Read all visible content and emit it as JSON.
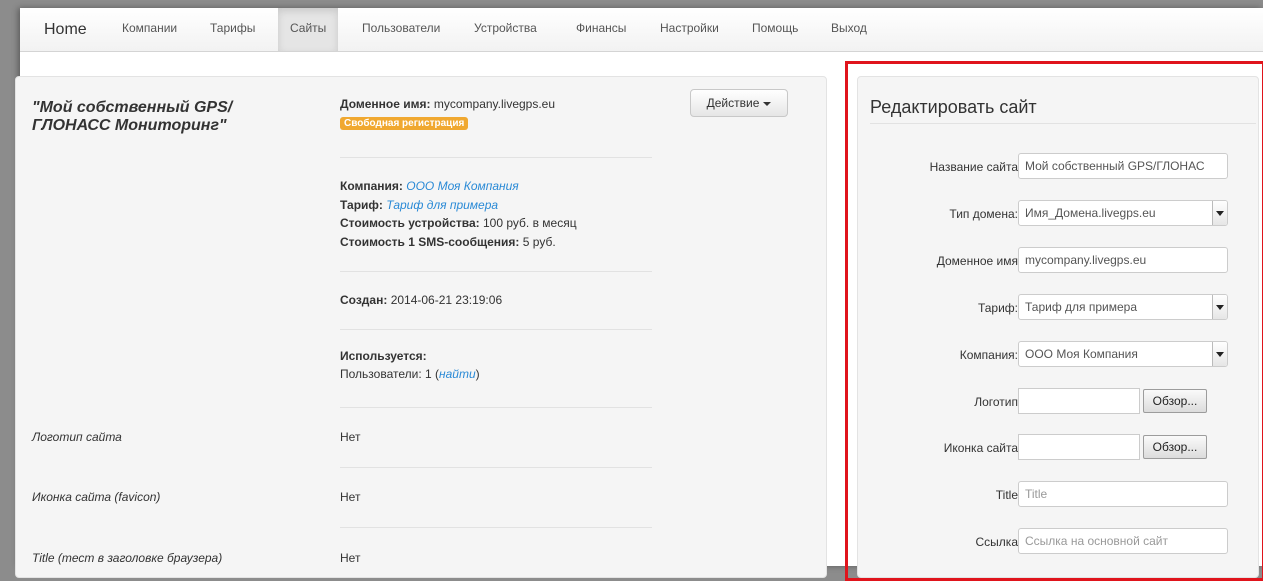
{
  "nav": {
    "brand": "Home",
    "items": [
      "Компании",
      "Тарифы",
      "Сайты",
      "Пользователи",
      "Устройства",
      "Финансы",
      "Настройки",
      "Помощь",
      "Выход"
    ],
    "active": "Сайты"
  },
  "site": {
    "title": "\"Мой собственный GPS/ ГЛОНАСС Мониторинг\"",
    "domain_label": "Доменное имя:",
    "domain_value": "mycompany.livegps.eu",
    "badge": "Свободная регистрация",
    "action_label": "Действие",
    "company_label": "Компания:",
    "company_value": "ООО Моя Компания",
    "tariff_label": "Тариф:",
    "tariff_value": "Тариф для примера",
    "device_cost_label": "Стоимость устройства:",
    "device_cost_value": "100 руб. в месяц",
    "sms_cost_label": "Стоимость 1 SMS-сообщения:",
    "sms_cost_value": "5 руб.",
    "created_label": "Создан:",
    "created_value": "2014-06-21 23:19:06",
    "used_label": "Используется:",
    "users_text": "Пользователи: 1 (",
    "users_link": "найти",
    "users_close": ")",
    "rows": [
      {
        "label": "Логотип сайта",
        "value": "Нет"
      },
      {
        "label": "Иконка сайта (favicon)",
        "value": "Нет"
      },
      {
        "label": "Title (тест в заголовке браузера)",
        "value": "Нет"
      }
    ]
  },
  "edit": {
    "title": "Редактировать сайт",
    "site_name_label": "Название сайта",
    "site_name_value": "Мой собственный GPS/ГЛОНАС",
    "domain_type_label": "Тип домена:",
    "domain_type_value": "Имя_Домена.livegps.eu",
    "domain_name_label": "Доменное имя",
    "domain_name_value": "mycompany.livegps.eu",
    "tariff_label": "Тариф:",
    "tariff_value": "Тариф для примера",
    "company_label": "Компания:",
    "company_value": "ООО Моя Компания",
    "logo_label": "Логотип",
    "favicon_label": "Иконка сайта",
    "browse_label": "Обзор...",
    "title_label": "Title",
    "title_placeholder": "Title",
    "link_label": "Ссылка",
    "link_placeholder": "Ссылка на основной сайт"
  },
  "colors": {
    "highlight_frame": "#e0141c",
    "badge": "#f0a830",
    "link": "#2a8ad6"
  }
}
